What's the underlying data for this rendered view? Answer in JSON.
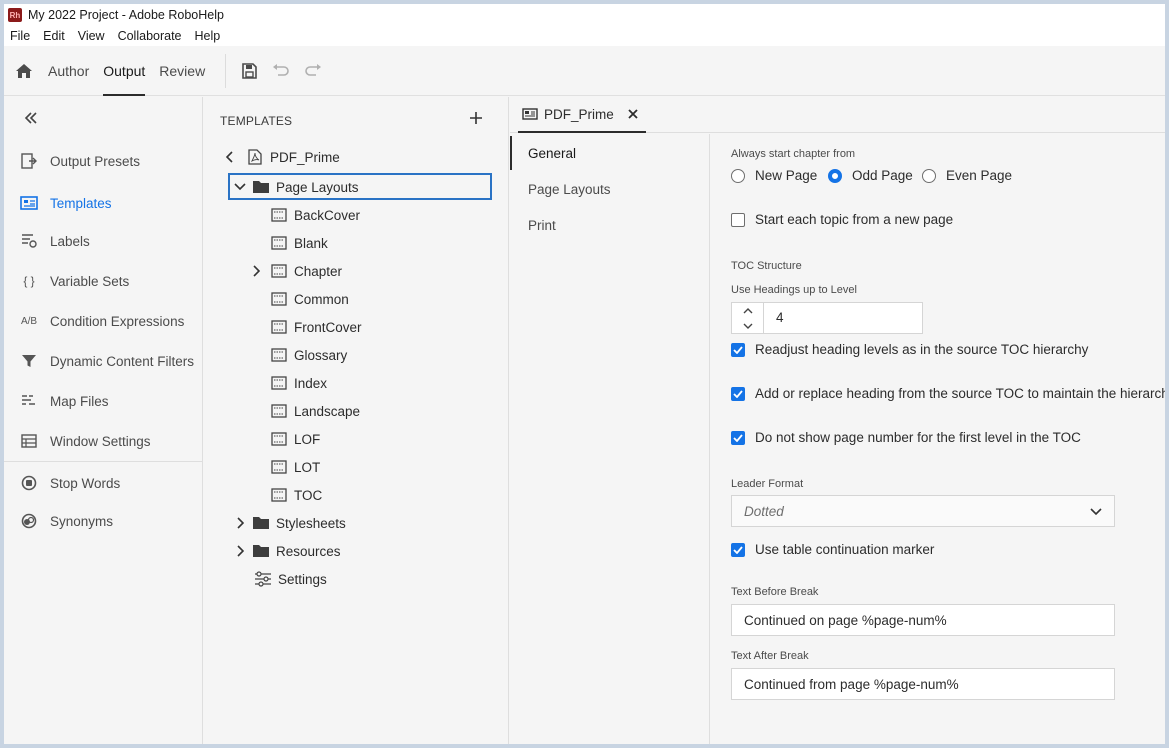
{
  "window": {
    "logo_text": "Rh",
    "title": "My 2022 Project - Adobe RoboHelp"
  },
  "menubar": [
    "File",
    "Edit",
    "View",
    "Collaborate",
    "Help"
  ],
  "modebar": {
    "tabs": [
      "Author",
      "Output",
      "Review"
    ],
    "active_tab": "Output",
    "tools": [
      "save-icon",
      "undo-icon",
      "redo-icon"
    ]
  },
  "leftpanel": {
    "items": [
      {
        "label": "Output Presets",
        "icon": "output-presets-icon"
      },
      {
        "label": "Templates",
        "icon": "templates-icon",
        "active": true
      },
      {
        "label": "Labels",
        "icon": "labels-icon"
      },
      {
        "label": "Variable Sets",
        "icon": "variable-sets-icon",
        "glyph": "{ }"
      },
      {
        "label": "Condition Expressions",
        "icon": "condition-expressions-icon",
        "glyph": "A/B"
      },
      {
        "label": "Dynamic Content Filters",
        "icon": "filter-icon"
      },
      {
        "label": "Map Files",
        "icon": "map-files-icon"
      },
      {
        "label": "Window Settings",
        "icon": "window-settings-icon"
      },
      {
        "label": "Stop Words",
        "icon": "stop-words-icon"
      },
      {
        "label": "Synonyms",
        "icon": "synonyms-icon"
      }
    ]
  },
  "tree": {
    "header": "TEMPLATES",
    "root": "PDF_Prime",
    "page_layouts": "Page Layouts",
    "layouts": [
      "BackCover",
      "Blank",
      "Chapter",
      "Common",
      "FrontCover",
      "Glossary",
      "Index",
      "Landscape",
      "LOF",
      "LOT",
      "TOC"
    ],
    "stylesheets": "Stylesheets",
    "resources": "Resources",
    "settings": "Settings"
  },
  "editor": {
    "tab_label": "PDF_Prime",
    "subnav": [
      "General",
      "Page Layouts",
      "Print"
    ],
    "active_subnav": "General",
    "form": {
      "chapter_start_label": "Always start chapter from",
      "chapter_start_options": [
        "New Page",
        "Odd Page",
        "Even Page"
      ],
      "chapter_start_selected": "Odd Page",
      "new_page_topic": {
        "label": "Start each topic from a new page",
        "checked": false
      },
      "toc_structure_label": "TOC Structure",
      "headings_level_label": "Use Headings up to Level",
      "headings_level_value": "4",
      "readjust": {
        "label": "Readjust heading levels as in the source TOC hierarchy",
        "checked": true
      },
      "add_replace": {
        "label": "Add or replace heading from the source TOC to maintain the hierarchy",
        "checked": true
      },
      "no_page_number": {
        "label": "Do not show page number for the first level in the TOC",
        "checked": true
      },
      "leader_format_label": "Leader Format",
      "leader_format_value": "Dotted",
      "continuation": {
        "label": "Use table continuation marker",
        "checked": true
      },
      "text_before_label": "Text Before Break",
      "text_before_value": "Continued on page %page-num%",
      "text_after_label": "Text After Break",
      "text_after_value": "Continued from page %page-num%"
    }
  },
  "colors": {
    "accent": "#1473e6",
    "selection_border": "#2a73c5",
    "logo_bg": "#8b1a1a"
  }
}
